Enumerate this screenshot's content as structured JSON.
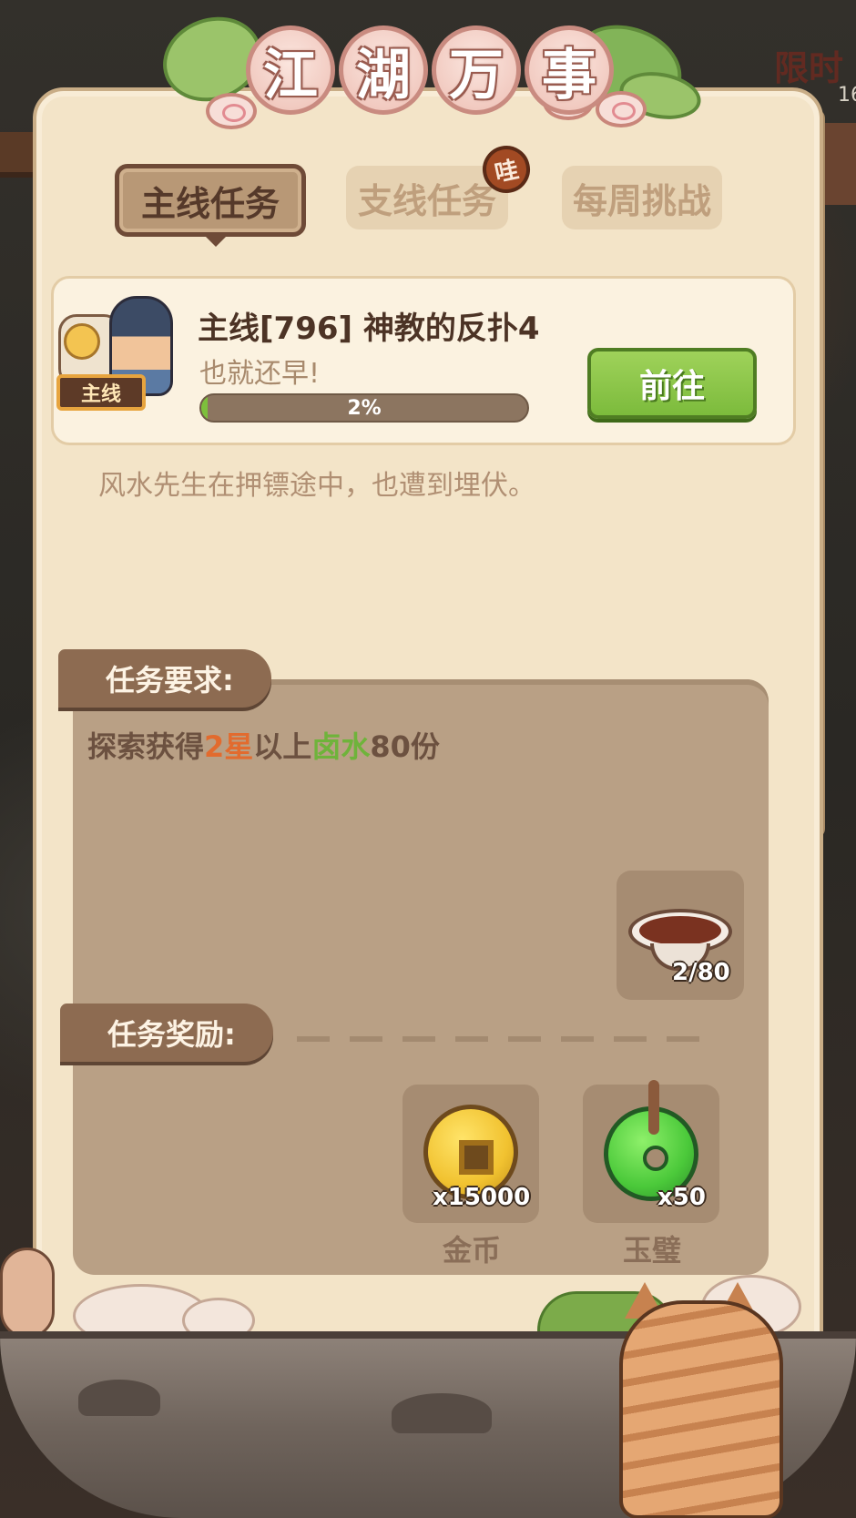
{
  "background": {
    "right_edge_text": "限时",
    "right_edge_sub": "16"
  },
  "title": {
    "chars": [
      "江",
      "湖",
      "万",
      "事"
    ]
  },
  "tabs": [
    {
      "label": "主线任务",
      "active": true
    },
    {
      "label": "支线任务",
      "active": false,
      "badge": "哇"
    },
    {
      "label": "每周挑战",
      "active": false
    }
  ],
  "quest": {
    "tag": "主线",
    "title": "主线[796] 神教的反扑4",
    "subtitle": "也就还早!",
    "progress_percent": 2,
    "progress_text": "2%",
    "go_button": "前往",
    "description": "风水先生在押镖途中，也遭到埋伏。"
  },
  "requirements": {
    "header": "任务要求:",
    "text_parts": [
      "探索获得",
      "2星",
      "以上",
      "卤水",
      "80份"
    ],
    "item": {
      "icon": "brine-bowl-icon",
      "count": "2/80"
    }
  },
  "rewards": {
    "header": "任务奖励:",
    "items": [
      {
        "icon": "gold-coin-icon",
        "count": "x15000",
        "label": "金币"
      },
      {
        "icon": "jade-disc-icon",
        "count": "x50",
        "label": "玉璧"
      }
    ]
  },
  "colors": {
    "accent_green": "#7cbb3c",
    "highlight_red": "#e26b2e",
    "highlight_green": "#6fb33b",
    "panel": "#f3e4c8"
  }
}
